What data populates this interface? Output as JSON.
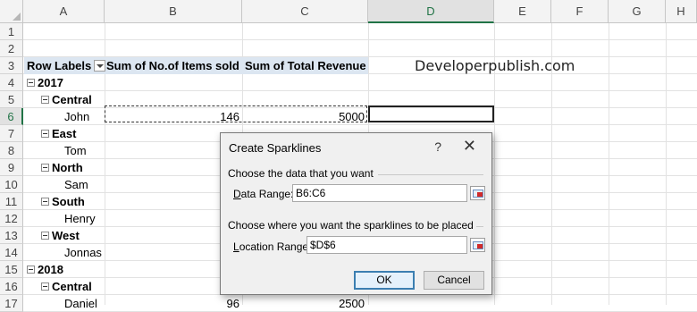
{
  "columns": [
    "A",
    "B",
    "C",
    "D",
    "E",
    "F",
    "G",
    "H"
  ],
  "rows": [
    "1",
    "2",
    "3",
    "4",
    "5",
    "6",
    "7",
    "8",
    "9",
    "10",
    "11",
    "12",
    "13",
    "14",
    "15",
    "16",
    "17"
  ],
  "pivot": {
    "header": {
      "row_labels": "Row Labels",
      "col_b": "Sum of No.of Items sold",
      "col_c": "Sum of Total Revenue"
    },
    "y2017": "2017",
    "central": "Central",
    "john": "John",
    "john_items": "146",
    "john_revenue": "5000",
    "east": "East",
    "tom": "Tom",
    "north": "North",
    "sam": "Sam",
    "south": "South",
    "henry": "Henry",
    "west": "West",
    "jonnas": "Jonnas",
    "y2018": "2018",
    "central2": "Central",
    "daniel": "Daniel",
    "daniel_items": "96",
    "daniel_revenue": "2500"
  },
  "watermark": "Developerpublish.com",
  "dialog": {
    "title": "Create Sparklines",
    "help": "?",
    "close": "✕",
    "section1": "Choose the data that you want",
    "data_range_label_u": "D",
    "data_range_label_rest": "ata Range:",
    "data_range_value": "B6:C6",
    "section2": "Choose where you want the sparklines to be placed",
    "location_label_u": "L",
    "location_label_rest": "ocation Range:",
    "location_value": "$D$6",
    "ok": "OK",
    "cancel": "Cancel"
  }
}
